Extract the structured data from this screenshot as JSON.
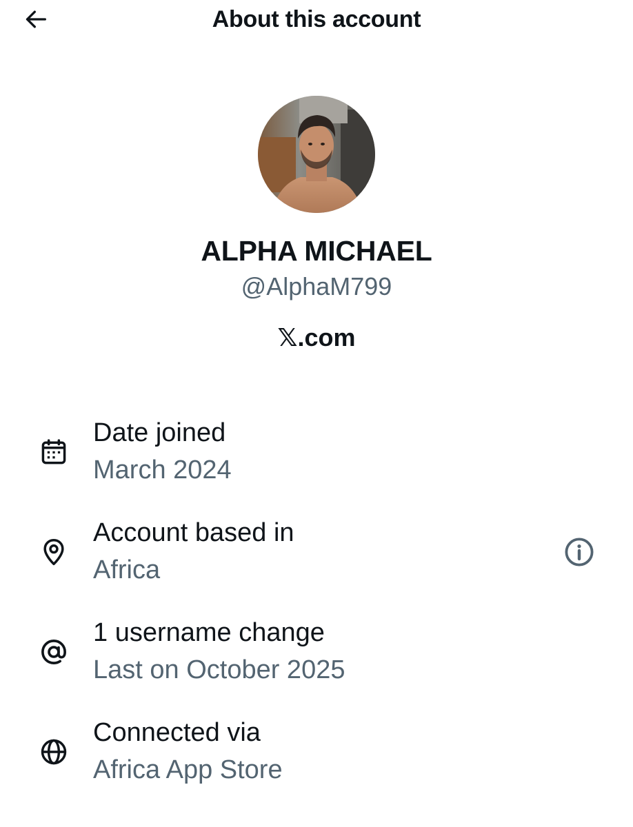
{
  "header": {
    "title": "About this account",
    "back_icon": "arrow-left-icon"
  },
  "profile": {
    "display_name": "ALPHA MICHAEL",
    "handle": "@AlphaM799",
    "platform": "𝕏.com",
    "avatar": "profile-photo"
  },
  "details": [
    {
      "icon": "calendar-icon",
      "label": "Date joined",
      "value": "March 2024"
    },
    {
      "icon": "location-pin-icon",
      "label": "Account based in",
      "value": "Africa",
      "trailing_icon": "info-icon"
    },
    {
      "icon": "at-sign-icon",
      "label": "1 username change",
      "value": "Last on October 2025"
    },
    {
      "icon": "globe-icon",
      "label": "Connected via",
      "value": "Africa App Store"
    }
  ],
  "colors": {
    "text_primary": "#0f1419",
    "text_secondary": "#536471",
    "background": "#ffffff"
  }
}
